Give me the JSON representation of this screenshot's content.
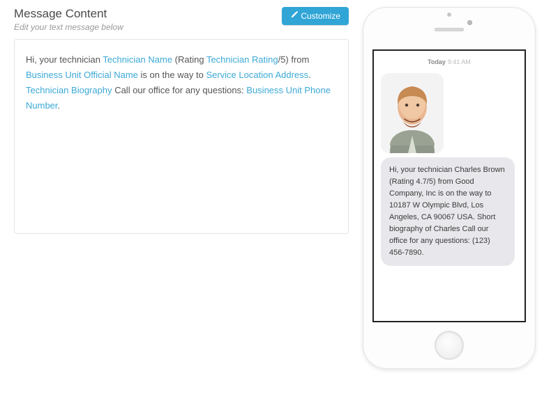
{
  "header": {
    "title": "Message Content",
    "subtitle": "Edit your text message below",
    "customize_label": "Customize"
  },
  "editor": {
    "parts": {
      "p1": "Hi, your technician ",
      "token_tech_name": "Technician Name",
      "p2": " (Rating ",
      "token_tech_rating": "Technician Rating",
      "p3": "/5) from ",
      "token_biz_name": "Business Unit Official Name",
      "p4": " is on the way to ",
      "token_service_addr": "Service Location Address",
      "p5": ". ",
      "token_bio": "Technician Biography",
      "p6": " Call our office for any questions: ",
      "token_phone": "Business Unit Phone Number",
      "p7": "."
    }
  },
  "preview": {
    "date_label": "Today",
    "time": "9:41 AM",
    "bubble_text": "Hi, your technician Charles Brown (Rating 4.7/5) from Good Company, Inc is on the way to 10187 W Olympic Blvd, Los Angeles, CA 90067 USA. Short biography of Charles Call our office for any questions: (123) 456-7890."
  }
}
